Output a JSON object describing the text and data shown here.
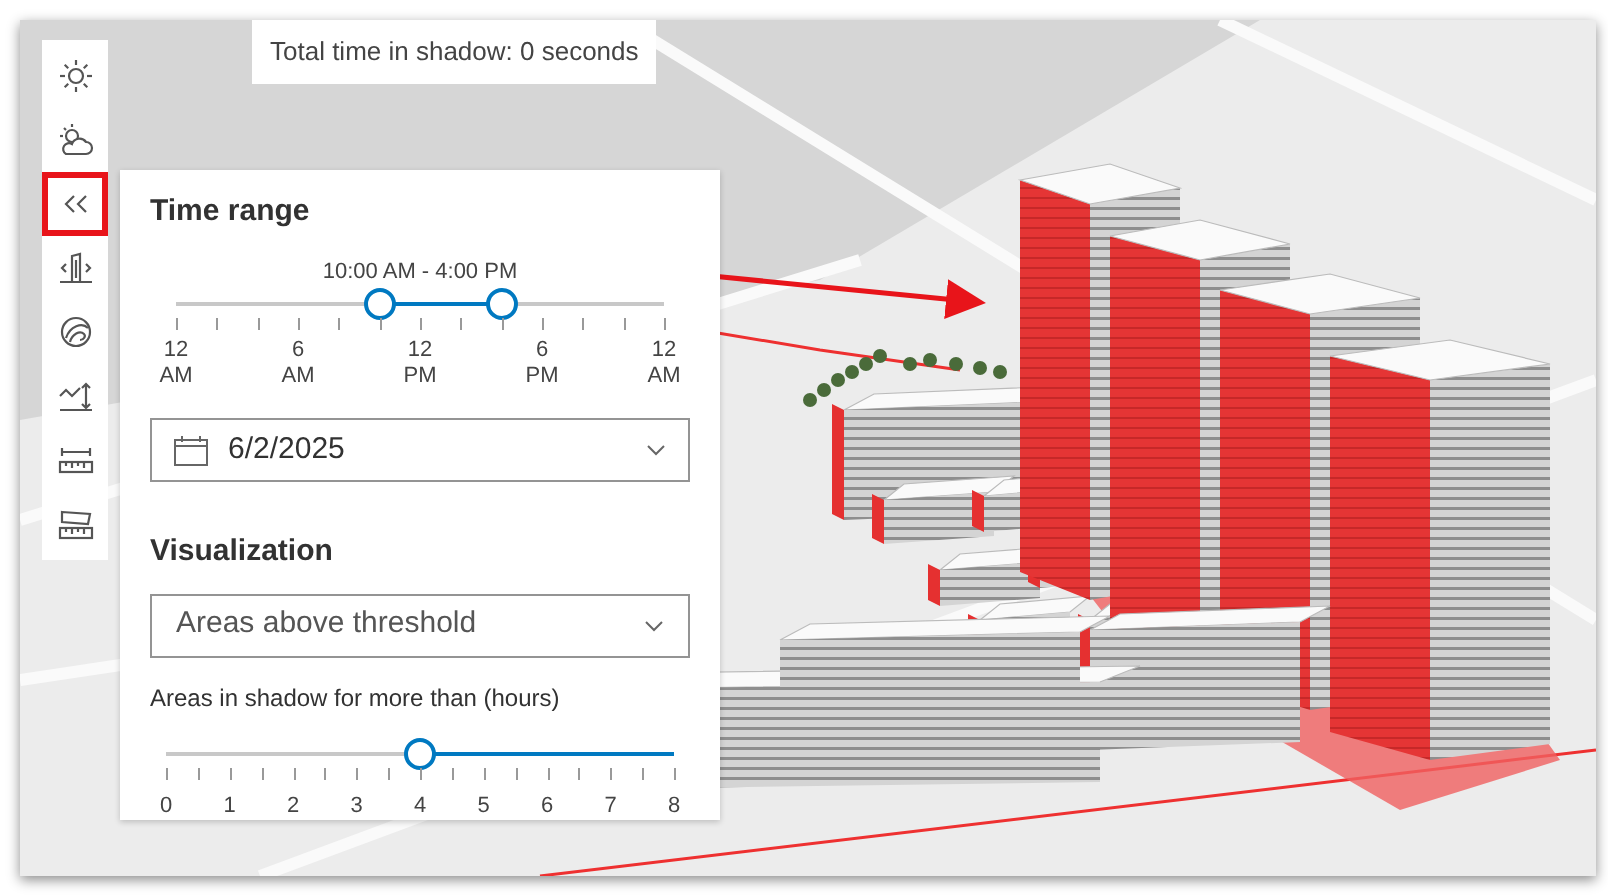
{
  "tooltip": {
    "text": "Total time in shadow: 0 seconds"
  },
  "toolbar": {
    "buttons": [
      {
        "kind": "sun",
        "highlighted": false
      },
      {
        "kind": "cloud",
        "highlighted": false
      },
      {
        "kind": "collapse",
        "highlighted": true
      },
      {
        "kind": "building",
        "highlighted": false
      },
      {
        "kind": "globe",
        "highlighted": false
      },
      {
        "kind": "elevation",
        "highlighted": false
      },
      {
        "kind": "distance",
        "highlighted": false
      },
      {
        "kind": "area",
        "highlighted": false
      }
    ]
  },
  "panel": {
    "time_range": {
      "title": "Time range",
      "range_label": "10:00 AM - 4:00 PM",
      "thumbs": [
        {
          "level": 0.4167
        },
        {
          "level": 0.6667
        }
      ],
      "ticks": [
        {
          "number": "12",
          "period": "AM"
        },
        {
          "number": "6",
          "period": "AM"
        },
        {
          "number": "12",
          "period": "PM"
        },
        {
          "number": "6",
          "period": "PM"
        },
        {
          "number": "12",
          "period": "AM"
        }
      ]
    },
    "date": {
      "value": "6/2/2025"
    },
    "visualization": {
      "title": "Visualization",
      "value": "Areas above threshold"
    },
    "threshold": {
      "label": "Areas in shadow for more than (hours)",
      "level": 0.5,
      "ticks": [
        "0",
        "1",
        "2",
        "3",
        "4",
        "5",
        "6",
        "7",
        "8"
      ]
    }
  }
}
